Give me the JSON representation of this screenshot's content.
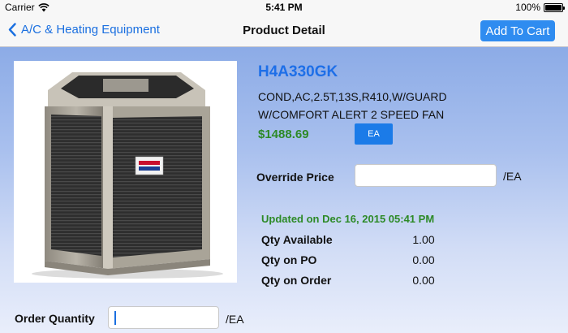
{
  "status_bar": {
    "carrier": "Carrier",
    "time": "5:41 PM",
    "battery_text": "100%",
    "battery_level": 1.0,
    "icons": [
      "wifi-icon",
      "battery-icon"
    ]
  },
  "nav": {
    "back_label": "A/C & Heating Equipment",
    "title": "Product Detail",
    "add_to_cart_label": "Add To Cart",
    "back_icon": "chevron-left-icon",
    "accent_color": "#1a6fe0"
  },
  "product": {
    "sku": "H4A330GK",
    "description_line1": "COND,AC,2.5T,13S,R410,W/GUARD",
    "description_line2": "W/COMFORT ALERT 2 SPEED FAN",
    "price": "$1488.69",
    "uom_button": "EA",
    "image": "air-conditioner-condenser-unit",
    "price_color": "#2d8a27"
  },
  "override": {
    "label": "Override Price",
    "value": "",
    "unit": "/EA"
  },
  "availability": {
    "updated_text": "Updated on Dec 16, 2015 05:41 PM",
    "rows": [
      {
        "label": "Qty Available",
        "value": "1.00"
      },
      {
        "label": "Qty on PO",
        "value": "0.00"
      },
      {
        "label": "Qty on Order",
        "value": "0.00"
      }
    ]
  },
  "order": {
    "label": "Order Quantity",
    "value": "",
    "unit": "/EA"
  }
}
